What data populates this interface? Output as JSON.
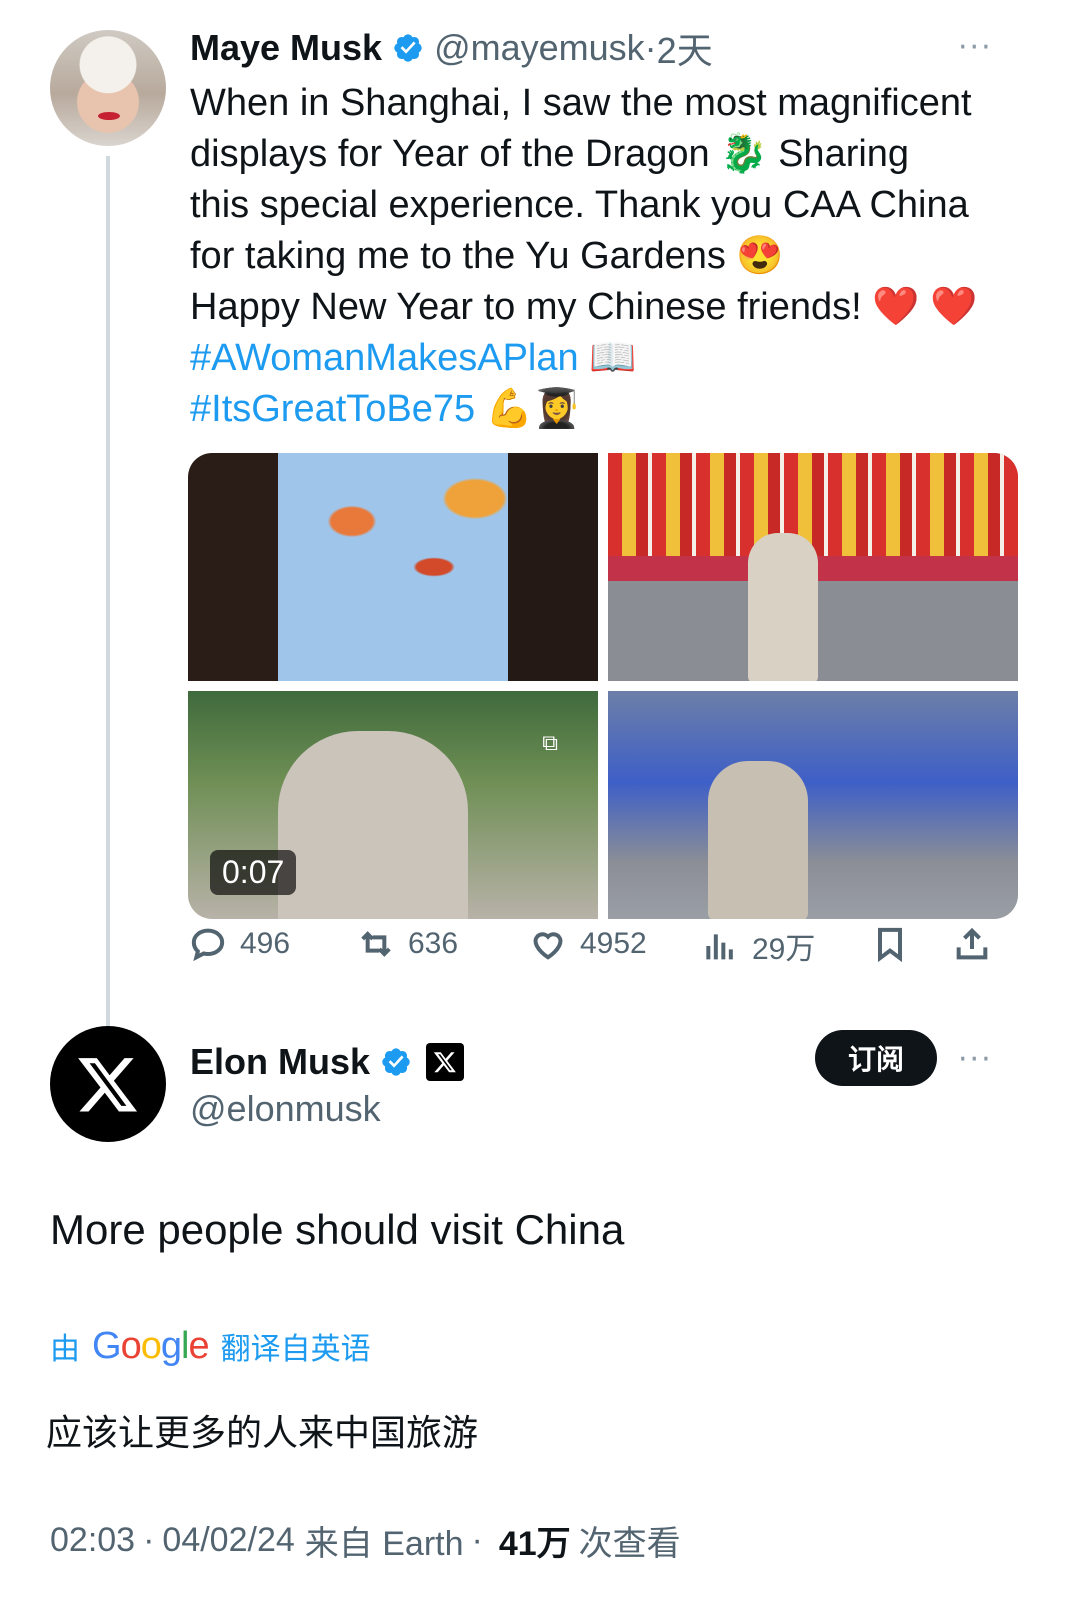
{
  "parent_tweet": {
    "author_name": "Maye Musk",
    "handle": "@mayemusk",
    "separator": "·",
    "age": "2天",
    "more": "···",
    "lines": [
      "When in Shanghai, I saw the most magnificent",
      "displays for Year of the Dragon 🐉 Sharing",
      "this special experience. Thank you CAA China",
      "for taking me to the Yu Gardens 😍",
      "Happy New Year to my Chinese friends! ❤️ ❤️"
    ],
    "hashtags": [
      "#AWomanMakesAPlan 📖",
      "#ItsGreatToBe75 💪👩‍🎓"
    ],
    "video_duration": "0:07",
    "actions": {
      "replies": "496",
      "reposts": "636",
      "likes": "4952",
      "views": "29万"
    }
  },
  "reply_tweet": {
    "author_name": "Elon Musk",
    "handle": "@elonmusk",
    "subscribe_label": "订阅",
    "more": "···",
    "text": "More people should visit China",
    "translate_prefix": "由",
    "translate_brand": [
      "G",
      "o",
      "o",
      "g",
      "l",
      "e"
    ],
    "translate_suffix": "翻译自英语",
    "translated_text": "应该让更多的人来中国旅游",
    "meta": {
      "time": "02:03",
      "separator": "·",
      "date": "04/02/24",
      "source": "来自 Earth",
      "views": "41万",
      "views_label": "次查看"
    }
  },
  "colors": {
    "link": "#1d9bf0",
    "text": "#0f1419",
    "secondary": "#536471",
    "verified": "#1d9bf0"
  }
}
